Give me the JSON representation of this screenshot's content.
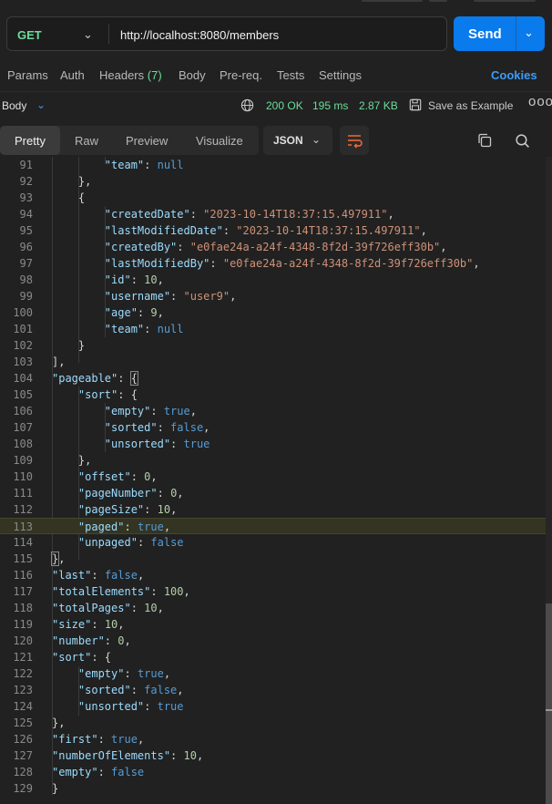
{
  "request": {
    "method": "GET",
    "url": "http://localhost:8080/members",
    "send_label": "Send"
  },
  "request_tabs": [
    {
      "label": "Params"
    },
    {
      "label": "Auth"
    },
    {
      "label": "Headers",
      "count": "(7)"
    },
    {
      "label": "Body"
    },
    {
      "label": "Pre-req."
    },
    {
      "label": "Tests"
    },
    {
      "label": "Settings"
    }
  ],
  "cookies_label": "Cookies",
  "response": {
    "body_label": "Body",
    "status": "200 OK",
    "time": "195 ms",
    "size": "2.87 KB",
    "save_label": "Save as Example",
    "more": "ooo"
  },
  "view_tabs": [
    "Pretty",
    "Raw",
    "Preview",
    "Visualize"
  ],
  "format": "JSON",
  "colors": {
    "accent": "#097bed",
    "success": "#6bdd9a",
    "link": "#3d9bf6"
  },
  "code_lines": [
    {
      "n": "91",
      "t": "            \"team\": null"
    },
    {
      "n": "92",
      "t": "        },"
    },
    {
      "n": "93",
      "t": "        {"
    },
    {
      "n": "94",
      "t": "            \"createdDate\": \"2023-10-14T18:37:15.497911\","
    },
    {
      "n": "95",
      "t": "            \"lastModifiedDate\": \"2023-10-14T18:37:15.497911\","
    },
    {
      "n": "96",
      "t": "            \"createdBy\": \"e0fae24a-a24f-4348-8f2d-39f726eff30b\","
    },
    {
      "n": "97",
      "t": "            \"lastModifiedBy\": \"e0fae24a-a24f-4348-8f2d-39f726eff30b\","
    },
    {
      "n": "98",
      "t": "            \"id\": 10,"
    },
    {
      "n": "99",
      "t": "            \"username\": \"user9\","
    },
    {
      "n": "100",
      "t": "            \"age\": 9,"
    },
    {
      "n": "101",
      "t": "            \"team\": null"
    },
    {
      "n": "102",
      "t": "        }"
    },
    {
      "n": "103",
      "t": "    ],"
    },
    {
      "n": "104",
      "t": "    \"pageable\": {"
    },
    {
      "n": "105",
      "t": "        \"sort\": {"
    },
    {
      "n": "106",
      "t": "            \"empty\": true,"
    },
    {
      "n": "107",
      "t": "            \"sorted\": false,"
    },
    {
      "n": "108",
      "t": "            \"unsorted\": true"
    },
    {
      "n": "109",
      "t": "        },"
    },
    {
      "n": "110",
      "t": "        \"offset\": 0,"
    },
    {
      "n": "111",
      "t": "        \"pageNumber\": 0,"
    },
    {
      "n": "112",
      "t": "        \"pageSize\": 10,"
    },
    {
      "n": "113",
      "t": "        \"paged\": true,"
    },
    {
      "n": "114",
      "t": "        \"unpaged\": false"
    },
    {
      "n": "115",
      "t": "    },"
    },
    {
      "n": "116",
      "t": "    \"last\": false,"
    },
    {
      "n": "117",
      "t": "    \"totalElements\": 100,"
    },
    {
      "n": "118",
      "t": "    \"totalPages\": 10,"
    },
    {
      "n": "119",
      "t": "    \"size\": 10,"
    },
    {
      "n": "120",
      "t": "    \"number\": 0,"
    },
    {
      "n": "121",
      "t": "    \"sort\": {"
    },
    {
      "n": "122",
      "t": "        \"empty\": true,"
    },
    {
      "n": "123",
      "t": "        \"sorted\": false,"
    },
    {
      "n": "124",
      "t": "        \"unsorted\": true"
    },
    {
      "n": "125",
      "t": "    },"
    },
    {
      "n": "126",
      "t": "    \"first\": true,"
    },
    {
      "n": "127",
      "t": "    \"numberOfElements\": 10,"
    },
    {
      "n": "128",
      "t": "    \"empty\": false"
    },
    {
      "n": "129",
      "t": "}"
    }
  ]
}
